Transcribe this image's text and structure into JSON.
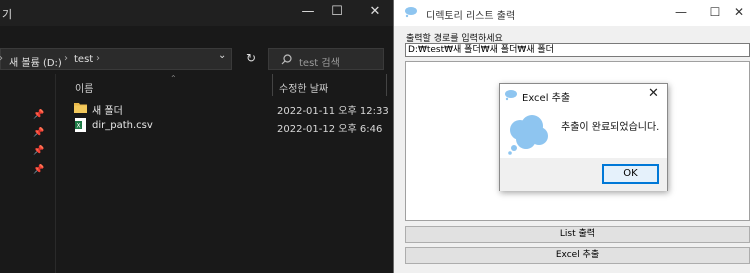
{
  "explorer": {
    "title_fragment": "기",
    "window_controls": {
      "minimize": "—",
      "maximize": "☐",
      "close": "✕"
    },
    "breadcrumb": [
      "새 볼륨 (D:)",
      "test"
    ],
    "breadcrumb_separator": "›",
    "refresh_icon": "↻",
    "search_placeholder": "test 검색",
    "columns": {
      "name": "이름",
      "modified": "수정한 날짜"
    },
    "files": [
      {
        "name": "새 폴더",
        "modified": "2022-01-11 오후 12:33",
        "icon": "folder-icon"
      },
      {
        "name": "dir_path.csv",
        "modified": "2022-01-12 오후 6:46",
        "icon": "csv-file-icon"
      }
    ]
  },
  "app": {
    "title": "디렉토리 리스트 출력",
    "window_controls": {
      "minimize": "—",
      "maximize": "☐",
      "close": "✕"
    },
    "prompt_label": "출력할 경로를 입력하세요",
    "path_value": "D:₩test₩새 폴더₩새 폴더₩새 폴더",
    "buttons": {
      "list_output": "List 출력",
      "excel_export": "Excel 추출"
    }
  },
  "message_box": {
    "title": "Excel 추출",
    "close": "✕",
    "message": "추출이 완료되었습니다.",
    "ok_label": "OK"
  },
  "colors": {
    "explorer_bg": "#191919",
    "app_bg": "#f0f0f0",
    "accent": "#0078d7",
    "cloud_icon": "#8ec5f0"
  }
}
